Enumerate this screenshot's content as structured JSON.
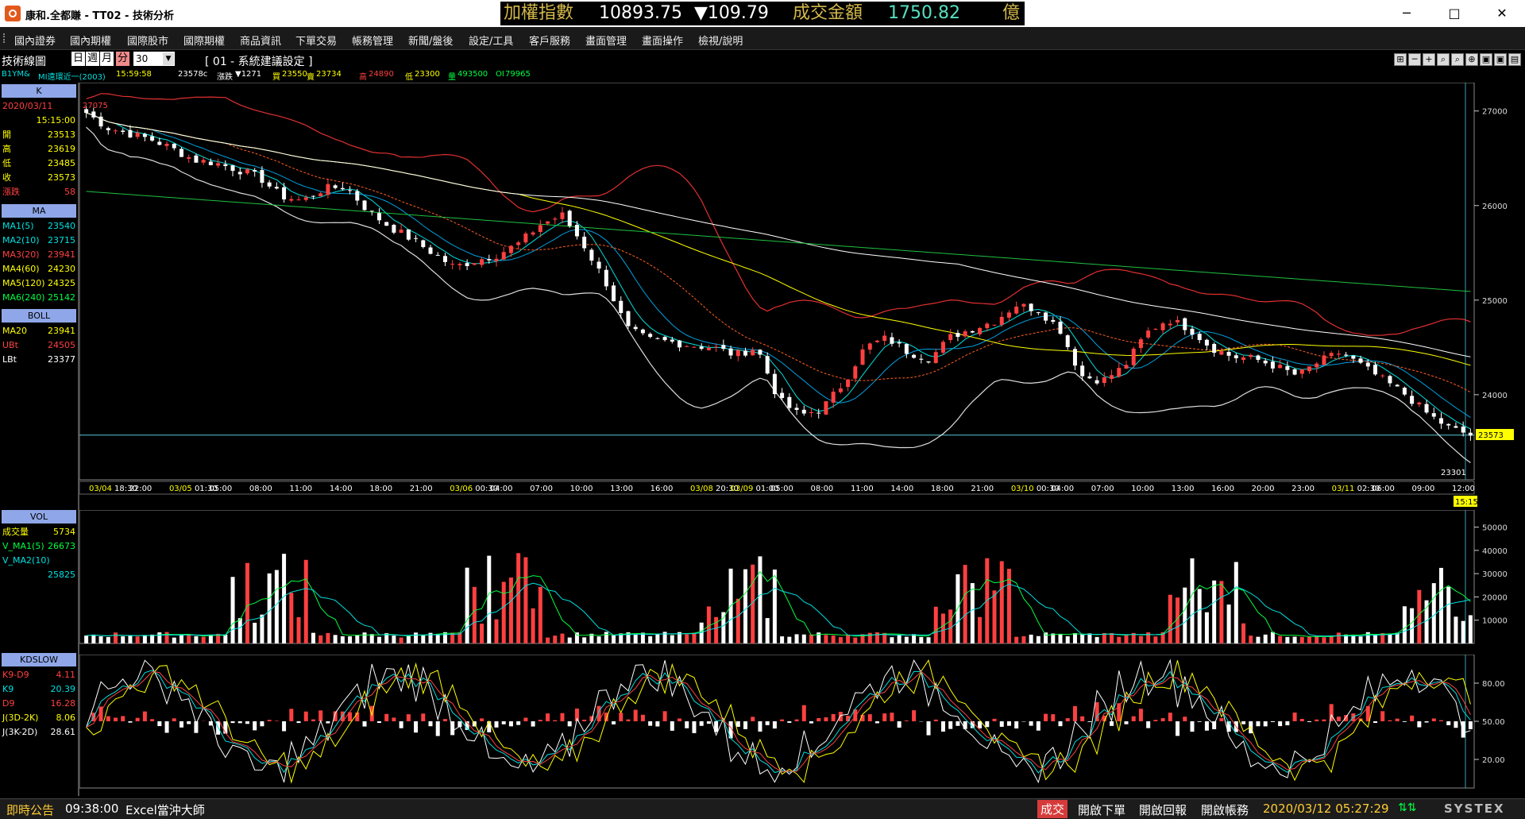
{
  "window": {
    "title": "康和.全都賺 - TT02 - 技術分析",
    "minimize": "─",
    "maximize": "□",
    "close": "✕"
  },
  "ticker": {
    "index_name": "加權指數",
    "index_value": "10893.75",
    "change": "▼109.79",
    "turnover_label": "成交金額",
    "turnover_value": "1750.82",
    "unit": "億",
    "colors": {
      "label": "#d4b84a",
      "value": "#ffffff",
      "turnover": "#55e0c0",
      "down": "#ffffff"
    }
  },
  "menu": [
    "國內證券",
    "國內期權",
    "國際股市",
    "國際期權",
    "商品資訊",
    "下單交易",
    "帳務管理",
    "新聞/盤後",
    "設定/工具",
    "客戶服務",
    "畫面管理",
    "畫面操作",
    "檢視/說明"
  ],
  "toolbar": {
    "label": "技術線圖",
    "periods": [
      "日",
      "週",
      "月",
      "分"
    ],
    "period_value": "30",
    "combo_arrow": "▼",
    "setting": "[ 01 - 系統建議設定 ]",
    "tools": [
      "⊞",
      "─",
      "+",
      "⌕",
      "⌕",
      "⊕",
      "▣",
      "▣",
      "▤"
    ]
  },
  "info_row": {
    "symbol": "B1YM&",
    "name": "MI遠環近一(2003)",
    "time": "15:59:58",
    "price": "23578c",
    "chg_label": "漲跌",
    "chg": "▼1271",
    "bid_label": "買",
    "bid": "23550",
    "ask_label": "賣",
    "ask": "23734",
    "high_label": "高",
    "high": "24890",
    "low_label": "低",
    "low": "23300",
    "vol_label": "量",
    "vol": "493500",
    "oi_label": "OI",
    "oi": "79965"
  },
  "left_panel": {
    "k": {
      "header": "K",
      "date": "2020/03/11",
      "time": "15:15:00",
      "rows": [
        {
          "label": "開",
          "value": "23513"
        },
        {
          "label": "高",
          "value": "23619"
        },
        {
          "label": "低",
          "value": "23485"
        },
        {
          "label": "收",
          "value": "23573"
        },
        {
          "label": "漲跌",
          "value": "58"
        }
      ]
    },
    "ma": {
      "header": "MA",
      "rows": [
        {
          "label": "MA1(5)",
          "value": "23540",
          "color": "#00e0e0"
        },
        {
          "label": "MA2(10)",
          "value": "23715",
          "color": "#00e0e0"
        },
        {
          "label": "MA3(20)",
          "value": "23941",
          "color": "#ff4040"
        },
        {
          "label": "MA4(60)",
          "value": "24230",
          "color": "#ffff00"
        },
        {
          "label": "MA5(120)",
          "value": "24325",
          "color": "#ffff00"
        },
        {
          "label": "MA6(240)",
          "value": "25142",
          "color": "#00ff40"
        }
      ]
    },
    "boll": {
      "header": "BOLL",
      "rows": [
        {
          "label": "MA20",
          "value": "23941",
          "color": "#ffff00"
        },
        {
          "label": "UBt",
          "value": "24505",
          "color": "#ff4040"
        },
        {
          "label": "LBt",
          "value": "23377",
          "color": "#ffffff"
        }
      ]
    },
    "vol": {
      "header": "VOL",
      "rows": [
        {
          "label": "成交量",
          "value": "5734",
          "color": "#ffff00"
        },
        {
          "label": "V_MA1(5)",
          "value": "26673",
          "color": "#00ff40"
        },
        {
          "label": "V_MA2(10)",
          "value": "",
          "color": "#00e0e0"
        },
        {
          "label": "",
          "value": "25825",
          "color": "#00e0e0"
        }
      ]
    },
    "kd": {
      "header": "KDSLOW",
      "rows": [
        {
          "label": "K9-D9",
          "value": "4.11",
          "color": "#ff4040"
        },
        {
          "label": "K9",
          "value": "20.39",
          "color": "#00e0e0"
        },
        {
          "label": "D9",
          "value": "16.28",
          "color": "#ff4040"
        },
        {
          "label": "J(3D-2K)",
          "value": "8.06",
          "color": "#ffff00"
        },
        {
          "label": "J(3K-2D)",
          "value": "28.61",
          "color": "#ffffff"
        }
      ]
    }
  },
  "price_chart": {
    "top_label": "27075",
    "low_label": "23301",
    "last_price": "23573",
    "last_time": "15:15",
    "ylim": [
      23100,
      27300
    ],
    "yticks": [
      27000,
      26000,
      25000,
      24000
    ],
    "hline": 23573,
    "xlabels": [
      {
        "t": "03/04",
        "s": "18:30"
      },
      {
        "t": "",
        "s": "22:00"
      },
      {
        "t": "03/05",
        "s": "01:30"
      },
      {
        "t": "",
        "s": "05:00"
      },
      {
        "t": "",
        "s": "08:00"
      },
      {
        "t": "",
        "s": "11:00"
      },
      {
        "t": "",
        "s": "14:00"
      },
      {
        "t": "",
        "s": "18:00"
      },
      {
        "t": "",
        "s": "21:00"
      },
      {
        "t": "03/06",
        "s": "00:30"
      },
      {
        "t": "",
        "s": "04:00"
      },
      {
        "t": "",
        "s": "07:00"
      },
      {
        "t": "",
        "s": "10:00"
      },
      {
        "t": "",
        "s": "13:00"
      },
      {
        "t": "",
        "s": "16:00"
      },
      {
        "t": "03/08",
        "s": "20:30"
      },
      {
        "t": "03/09",
        "s": "01:00"
      },
      {
        "t": "",
        "s": "05:00"
      },
      {
        "t": "",
        "s": "08:00"
      },
      {
        "t": "",
        "s": "11:00"
      },
      {
        "t": "",
        "s": "14:00"
      },
      {
        "t": "",
        "s": "18:00"
      },
      {
        "t": "",
        "s": "21:00"
      },
      {
        "t": "03/10",
        "s": "00:30"
      },
      {
        "t": "",
        "s": "04:00"
      },
      {
        "t": "",
        "s": "07:00"
      },
      {
        "t": "",
        "s": "10:00"
      },
      {
        "t": "",
        "s": "13:00"
      },
      {
        "t": "",
        "s": "16:00"
      },
      {
        "t": "",
        "s": "20:00"
      },
      {
        "t": "",
        "s": "23:00"
      },
      {
        "t": "03/11",
        "s": "02:30"
      },
      {
        "t": "",
        "s": "06:00"
      },
      {
        "t": "",
        "s": "09:00"
      },
      {
        "t": "",
        "s": "12:00"
      }
    ]
  },
  "vol_chart": {
    "ylim": [
      0,
      56000
    ],
    "yticks": [
      50000,
      40000,
      30000,
      20000,
      10000
    ]
  },
  "kd_chart": {
    "ylim": [
      0,
      100
    ],
    "yticks": [
      80,
      50,
      20
    ]
  },
  "chart_data": {
    "type": "candlestick",
    "close_path": [
      26980,
      26820,
      26760,
      26700,
      26600,
      26480,
      26450,
      26380,
      26300,
      26100,
      26050,
      26180,
      26200,
      25950,
      25780,
      25650,
      25500,
      25350,
      25420,
      25480,
      25600,
      25800,
      25900,
      25580,
      25200,
      24700,
      24580,
      24560,
      24520,
      24500,
      24420,
      24500,
      23950,
      23780,
      23850,
      24120,
      24500,
      24600,
      24450,
      24380,
      24620,
      24700,
      24780,
      24950,
      24900,
      24700,
      24200,
      24150,
      24300,
      24650,
      24800,
      24700,
      24500,
      24400,
      24380,
      24300,
      24200,
      24350,
      24450,
      24300,
      24150,
      24000,
      23800,
      23650,
      23573
    ],
    "ma_lines": [
      {
        "name": "MA1(5)",
        "color": "#00e0e0"
      },
      {
        "name": "MA2(10)",
        "color": "#00e0e0"
      },
      {
        "name": "MA3(20)",
        "color": "#ff4040"
      },
      {
        "name": "MA4(60)",
        "color": "#ffff00"
      },
      {
        "name": "MA5(120)",
        "color": "#ffff00"
      },
      {
        "name": "MA6(240)",
        "color": "#00ff40"
      }
    ]
  },
  "statusbar": {
    "notice": "即時公告",
    "time": "09:38:00",
    "msg": "Excel當沖大師",
    "deal": "成交",
    "order": "開啟下單",
    "report": "開啟回報",
    "account": "開啟帳務",
    "datetime": "2020/03/12 05:27:29",
    "brand": "SYSTEX"
  }
}
